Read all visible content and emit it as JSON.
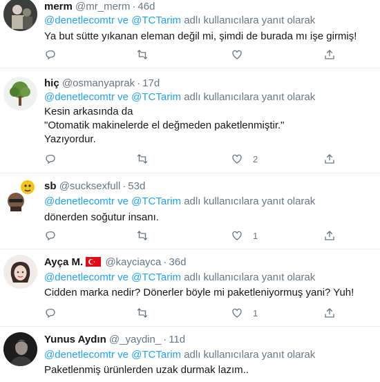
{
  "reply_label": "adlı kullanıcılara yanıt olarak",
  "reply_and": "ve",
  "dot": "·",
  "tweets": [
    {
      "name": "merm",
      "handle": "@mr_merm",
      "time": "46d",
      "mentions": [
        "@denetlecomtr",
        "@TCTarim"
      ],
      "text": "Ya but sütte yıkanan eleman değil mi, şimdi de burada mı işe girmiş!",
      "likes": ""
    },
    {
      "name": "hiç",
      "handle": "@osmanyaprak",
      "time": "17d",
      "mentions": [
        "@denetlecomtr",
        "@TCTarim"
      ],
      "text": "Kesin arkasında da\n\"Otomatik makinelerde el değmeden paketlenmiştir.\"\nYazıyordur.",
      "likes": "2"
    },
    {
      "name": "sb",
      "handle": "@sucksexfull",
      "time": "53d",
      "mentions": [
        "@denetlecomtr",
        "@TCTarim"
      ],
      "text": "dönerden soğutur insanı.",
      "likes": "1"
    },
    {
      "name": "Ayça M.",
      "handle": "@kayciayca",
      "time": "36d",
      "mentions": [
        "@denetlecomtr",
        "@TCTarim"
      ],
      "text": "Cidden marka nedir? Dönerler böyle mi paketleniyormuş yani? Yuh!",
      "likes": "1"
    },
    {
      "name": "Yunus Aydın",
      "handle": "@_yaydin_",
      "time": "11d",
      "mentions": [
        "@denetlecomtr",
        "@TCTarim"
      ],
      "text": "Paketlenmiş ürünlerden uzak durmak lazım..",
      "likes": ""
    }
  ],
  "icons": [
    "reply-icon",
    "retweet-icon",
    "heart-icon",
    "share-icon",
    "turkey-flag-icon"
  ],
  "colors": {
    "link": "#1da1f2",
    "secondary": "#657786",
    "text": "#14171a",
    "divider": "#e6ecf0"
  }
}
